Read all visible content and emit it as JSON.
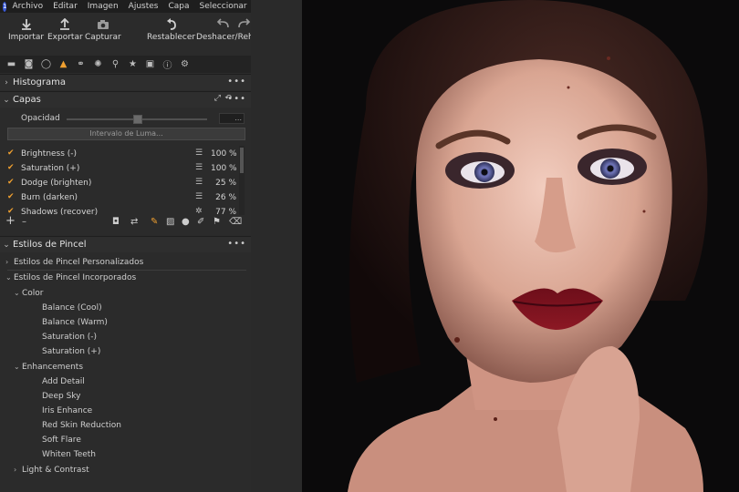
{
  "menu": [
    "Archivo",
    "Editar",
    "Imagen",
    "Ajustes",
    "Capa",
    "Seleccionar"
  ],
  "toolbar": {
    "import": "Importar",
    "export": "Exportar",
    "capture": "Capturar",
    "reset": "Restablecer",
    "undo_redo": "Deshacer/Rehacer"
  },
  "tool_tabs": [
    "folder-icon",
    "camera-icon",
    "circle-icon",
    "layers-icon",
    "color-icon",
    "sun-icon",
    "search-icon",
    "star-icon",
    "clipboard-icon",
    "info-icon",
    "gear-icon"
  ],
  "histogram": {
    "title": "Histograma"
  },
  "layers_panel": {
    "title": "Capas",
    "opacity_label": "Opacidad",
    "opacity_value": "...",
    "luma_button": "Intervalo de Luma...",
    "layers": [
      {
        "name": "Brightness (-)",
        "percent": "100 %"
      },
      {
        "name": "Saturation (+)",
        "percent": "100 %"
      },
      {
        "name": "Dodge (brighten)",
        "percent": "25 %"
      },
      {
        "name": "Burn (darken)",
        "percent": "26 %"
      },
      {
        "name": "Shadows (recover)",
        "percent": "77 %"
      }
    ]
  },
  "brush_panel": {
    "title": "Estilos de Pincel",
    "custom": "Estilos de Pincel Personalizados",
    "builtin": "Estilos de Pincel Incorporados",
    "color_group": "Color",
    "color_items": [
      "Balance (Cool)",
      "Balance (Warm)",
      "Saturation (-)",
      "Saturation (+)"
    ],
    "enh_group": "Enhancements",
    "enh_items": [
      "Add Detail",
      "Deep Sky",
      "Iris Enhance",
      "Red Skin Reduction",
      "Soft Flare",
      "Whiten Teeth"
    ],
    "light_group": "Light & Contrast"
  },
  "colors": {
    "accent": "#f0a030",
    "panel": "#2b2b2b"
  }
}
